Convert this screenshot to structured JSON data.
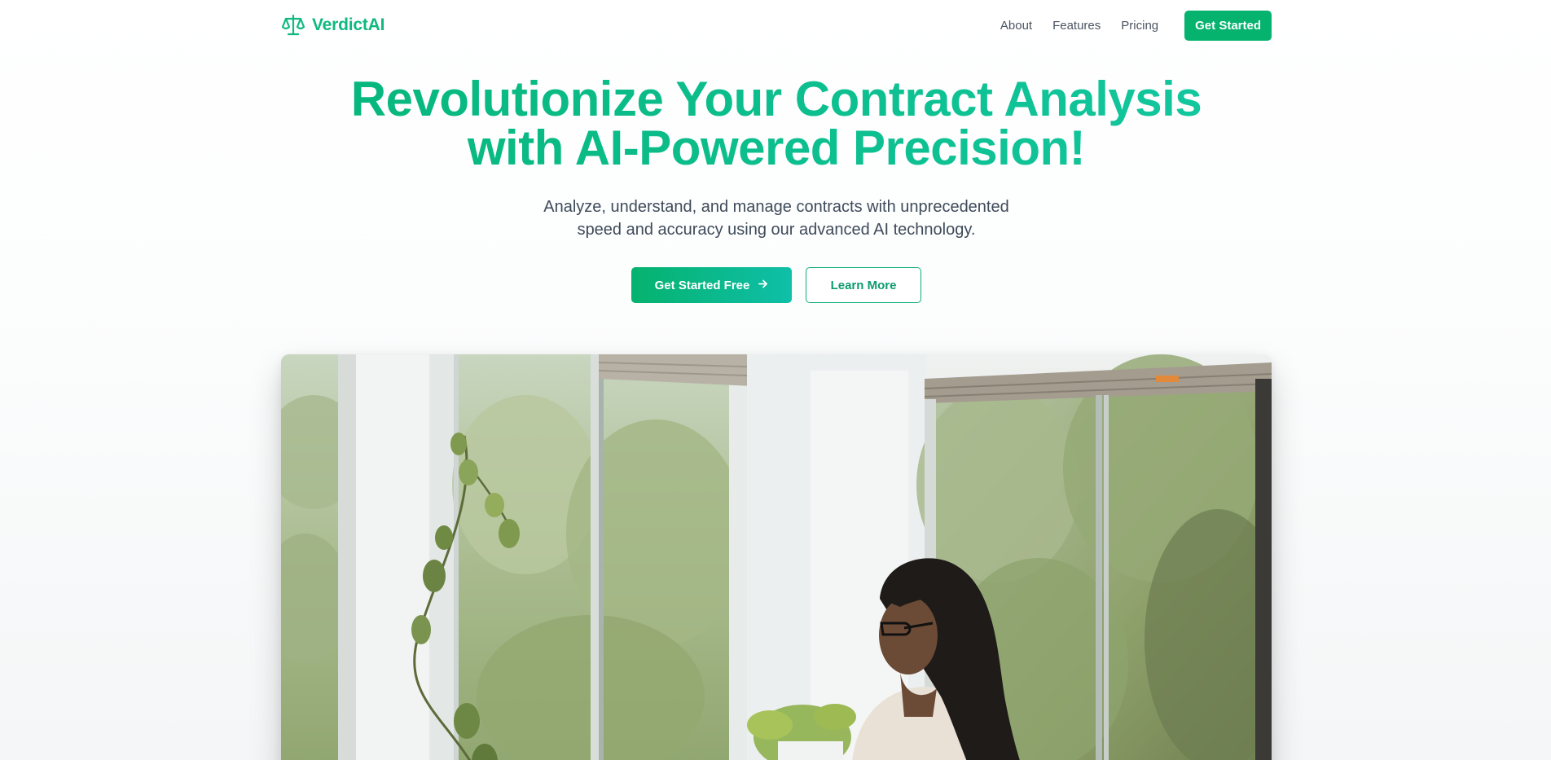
{
  "brand": {
    "name": "VerdictAI",
    "logo_icon": "scale-icon",
    "color": "#10b981"
  },
  "nav": {
    "links": [
      {
        "label": "About"
      },
      {
        "label": "Features"
      },
      {
        "label": "Pricing"
      }
    ],
    "cta_label": "Get Started"
  },
  "hero": {
    "headline_line1": "Revolutionize Your Contract Analysis",
    "headline_line2": "with AI-Powered Precision!",
    "subheading_line1": "Analyze, understand, and manage contracts with unprecedented",
    "subheading_line2": "speed and accuracy using our advanced AI technology.",
    "primary_cta": {
      "label": "Get Started Free",
      "icon": "arrow-right-icon"
    },
    "secondary_cta": {
      "label": "Learn More"
    },
    "image_alt": "Woman with braids and glasses working beside large windows with a hanging plant"
  },
  "colors": {
    "accent": "#05b26e",
    "accent_gradient_end": "#13c7a0",
    "text_body": "#3f4b5a",
    "nav_text": "#4b5563"
  }
}
